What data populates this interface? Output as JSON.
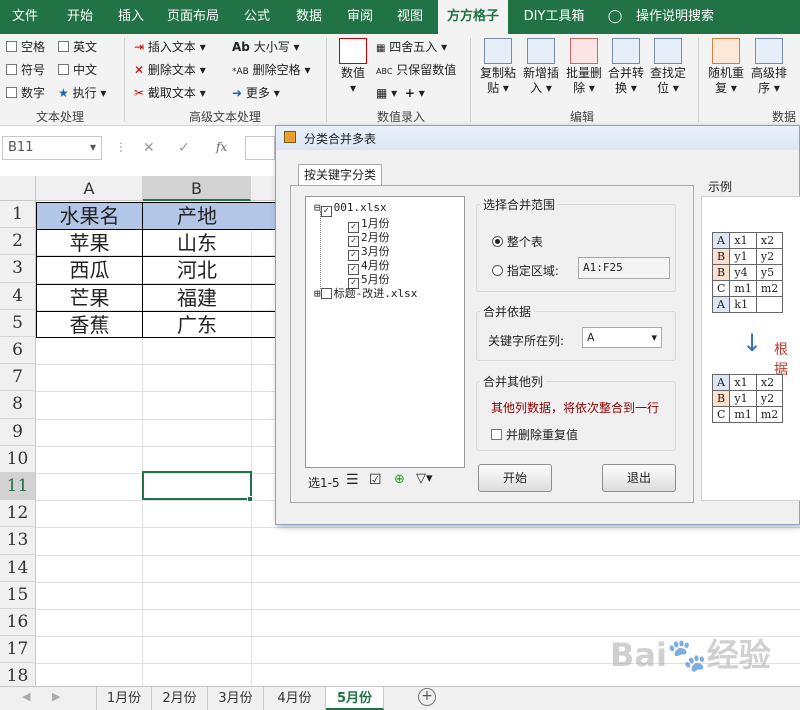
{
  "ribbon": {
    "tabs": [
      "文件",
      "开始",
      "插入",
      "页面布局",
      "公式",
      "数据",
      "审阅",
      "视图",
      "方方格子",
      "DIY工具箱",
      "操作说明搜索"
    ],
    "active_tab": "方方格子",
    "text_proc": {
      "items": [
        "空格",
        "英文",
        "符号",
        "中文",
        "数字",
        "执行"
      ],
      "label": "文本处理"
    },
    "adv_text": {
      "items": [
        "插入文本",
        "删除文本",
        "截取文本",
        "大小写",
        "删除空格",
        "更多"
      ],
      "label": "高级文本处理"
    },
    "num_entry": {
      "items": [
        "数值",
        "四舍五入",
        "只保留数值"
      ],
      "label": "数值录入"
    },
    "edit": {
      "items": [
        [
          "复制粘",
          "贴"
        ],
        [
          "新增插",
          "入"
        ],
        [
          "批量删",
          "除"
        ],
        [
          "合并转",
          "换"
        ],
        [
          "查找定",
          "位"
        ]
      ],
      "label": "编辑"
    },
    "data_grp": {
      "items": [
        [
          "随机重",
          "复"
        ],
        [
          "高级排",
          "序"
        ]
      ],
      "label": "数据"
    }
  },
  "formula_bar": {
    "cell_ref": "B11",
    "fx": "fx"
  },
  "grid": {
    "columns": [
      "A",
      "B"
    ],
    "rows": [
      "1",
      "2",
      "3",
      "4",
      "5",
      "6",
      "7",
      "8",
      "9",
      "10",
      "11",
      "12",
      "13",
      "14",
      "15",
      "16",
      "17",
      "18"
    ],
    "headers": [
      "水果名",
      "产地"
    ],
    "data": [
      [
        "苹果",
        "山东"
      ],
      [
        "西瓜",
        "河北"
      ],
      [
        "芒果",
        "福建"
      ],
      [
        "香蕉",
        "广东"
      ]
    ]
  },
  "sheets": [
    "1月份",
    "2月份",
    "3月份",
    "4月份",
    "5月份"
  ],
  "active_sheet": "5月份",
  "dialog": {
    "title": "分类合并多表",
    "tab": "按关键字分类",
    "tree": {
      "file1": "001.xlsx",
      "sheets": [
        "1月份",
        "2月份",
        "3月份",
        "4月份",
        "5月份"
      ],
      "file2": "标题-改进.xlsx"
    },
    "selection": "选1-5",
    "range": {
      "title": "选择合并范围",
      "whole": "整个表",
      "specific": "指定区域:",
      "range_value": "A1:F25"
    },
    "basis": {
      "title": "合并依据",
      "key_col_label": "关键字所在列:",
      "key_col_value": "A"
    },
    "others": {
      "title": "合并其他列",
      "note": "其他列数据，将依次整合到一行",
      "dedupe": "并删除重复值"
    },
    "start": "开始",
    "exit": "退出",
    "example": {
      "title": "示例",
      "top": [
        [
          "A",
          "x1",
          "x2"
        ],
        [
          "B",
          "y1",
          "y2"
        ],
        [
          "B",
          "y4",
          "y5"
        ],
        [
          "C",
          "m1",
          "m2"
        ],
        [
          "A",
          "k1",
          ""
        ]
      ],
      "arrow_label": "根据",
      "bottom": [
        [
          "A",
          "x1",
          "x2"
        ],
        [
          "B",
          "y1",
          "y2"
        ],
        [
          "C",
          "m1",
          "m2"
        ]
      ]
    }
  },
  "watermark": "Bai经验",
  "colors": {
    "excel_green": "#217346",
    "header_blue": "#b4c6e7",
    "dark_red": "#8b0000"
  }
}
